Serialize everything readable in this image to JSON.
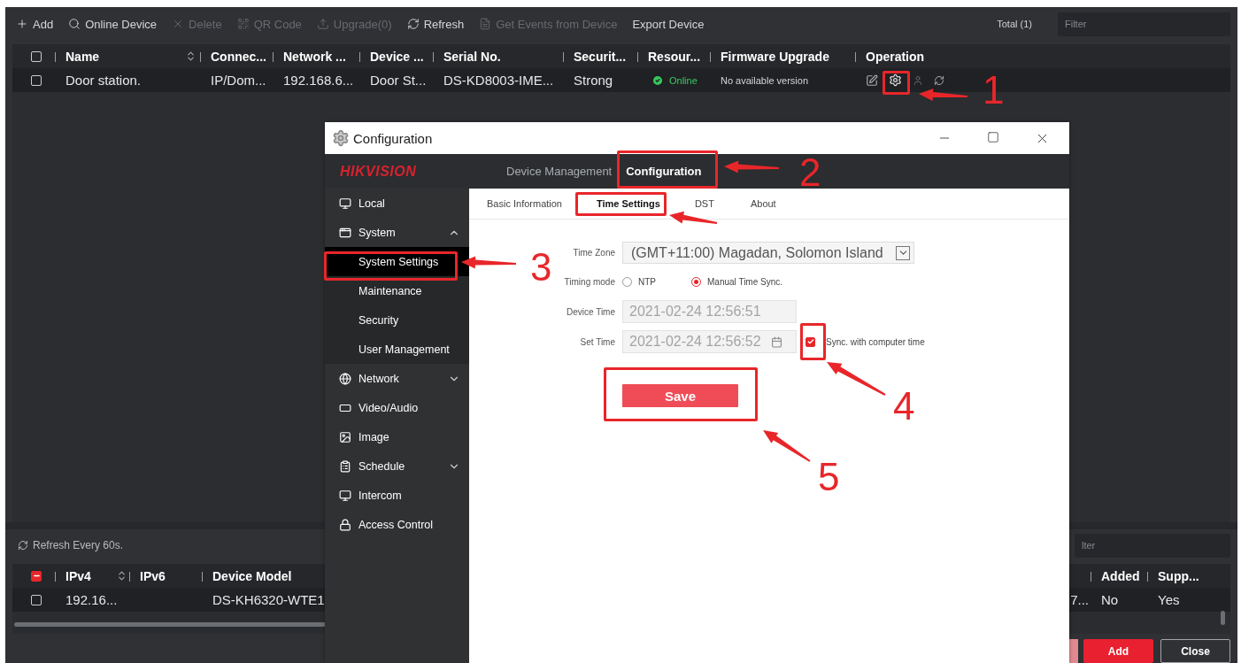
{
  "toolbar": {
    "buttons": [
      {
        "label": "Add",
        "disabled": false
      },
      {
        "label": "Online Device",
        "disabled": false
      },
      {
        "label": "Delete",
        "disabled": true
      },
      {
        "label": "QR Code",
        "disabled": true
      },
      {
        "label": "Upgrade(0)",
        "disabled": true
      },
      {
        "label": "Refresh",
        "disabled": false
      },
      {
        "label": "Get Events from Device",
        "disabled": true
      },
      {
        "label": "Export Device",
        "disabled": false
      }
    ],
    "total": "Total (1)",
    "filter": {
      "placeholder": "Filter"
    }
  },
  "device_table": {
    "select_all_checked": false,
    "columns": [
      "Name",
      "Connec...",
      "Network ...",
      "Device ...",
      "Serial No.",
      "Securit...",
      "Resour...",
      "Firmware Upgrade",
      "Operation"
    ],
    "rows": [
      {
        "checked": false,
        "cells": [
          "Door station.",
          "IP/Dom...",
          "192.168.6...",
          "Door St...",
          "DS-KD8003-IME...",
          "Strong"
        ],
        "status": "Online",
        "firmware": "No available version"
      }
    ]
  },
  "online_panel": {
    "refresh": "Refresh Every 60s.",
    "filter": {
      "placeholder": "lter"
    },
    "select_all": {
      "indeterminate": true
    },
    "columns": {
      "ipv4": "IPv4",
      "ipv6": "IPv6",
      "device_model": "Device Model",
      "added": "Added",
      "supported": "Supp..."
    },
    "rows": [
      {
        "checked": false,
        "ipv4": "192.16...",
        "device_model": "DS-KH6320-WTE1",
        "column_5": "7...",
        "added": "No",
        "supported": "Yes"
      }
    ],
    "buttons": [
      "Add",
      "Close"
    ]
  },
  "dialog": {
    "title": "Configuration",
    "brand": "HIKVISION",
    "nav": [
      {
        "label": "Device Management",
        "selected": false
      },
      {
        "label": "Configuration",
        "selected": true
      }
    ],
    "sidebar": [
      {
        "label": "Local",
        "kind": "item",
        "selected": false
      },
      {
        "label": "System",
        "kind": "group",
        "expanded": true,
        "children": [
          {
            "label": "System Settings",
            "selected": true
          },
          {
            "label": "Maintenance",
            "selected": false
          },
          {
            "label": "Security",
            "selected": false
          },
          {
            "label": "User Management",
            "selected": false
          }
        ]
      },
      {
        "label": "Network",
        "kind": "group",
        "expanded": false
      },
      {
        "label": "Video/Audio",
        "kind": "item",
        "selected": false
      },
      {
        "label": "Image",
        "kind": "item",
        "selected": false
      },
      {
        "label": "Schedule",
        "kind": "group",
        "expanded": false
      },
      {
        "label": "Intercom",
        "kind": "item",
        "selected": false
      },
      {
        "label": "Access Control",
        "kind": "item",
        "selected": false
      }
    ],
    "tabs": [
      {
        "label": "Basic Information",
        "selected": false
      },
      {
        "label": "Time Settings",
        "selected": true
      },
      {
        "label": "DST",
        "selected": false
      },
      {
        "label": "About",
        "selected": false
      }
    ],
    "form": {
      "time_zone": {
        "label": "Time Zone",
        "value": "(GMT+11:00) Magadan, Solomon Island"
      },
      "timing_mode": {
        "label": "Timing mode",
        "options": [
          {
            "label": "NTP",
            "selected": false
          },
          {
            "label": "Manual Time Sync.",
            "selected": true
          }
        ]
      },
      "device_time": {
        "label": "Device Time",
        "value": "2021-02-24 12:56:51",
        "disabled": true
      },
      "set_time": {
        "label": "Set Time",
        "value": "2021-02-24 12:56:52",
        "disabled": true
      },
      "sync": {
        "label": "Sync. with computer time",
        "checked": true
      },
      "save": "Save"
    }
  },
  "annotations": [
    "1",
    "2",
    "3",
    "4",
    "5"
  ]
}
